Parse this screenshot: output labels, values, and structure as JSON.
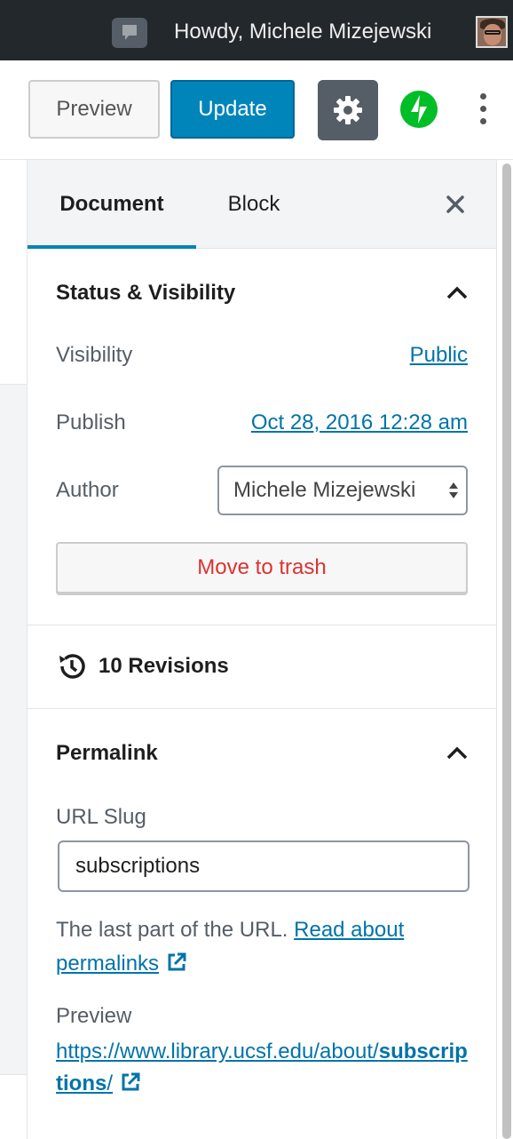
{
  "admin_bar": {
    "greeting": "Howdy, Michele Mizejewski"
  },
  "toolbar": {
    "preview_label": "Preview",
    "update_label": "Update"
  },
  "sidebar": {
    "tabs": [
      {
        "label": "Document",
        "active": true
      },
      {
        "label": "Block",
        "active": false
      }
    ],
    "status_visibility": {
      "title": "Status & Visibility",
      "visibility_label": "Visibility",
      "visibility_value": "Public",
      "publish_label": "Publish",
      "publish_value": "Oct 28, 2016 12:28 am",
      "author_label": "Author",
      "author_value": "Michele Mizejewski",
      "trash_label": "Move to trash"
    },
    "revisions": {
      "label": "10 Revisions"
    },
    "permalink": {
      "title": "Permalink",
      "slug_label": "URL Slug",
      "slug_value": "subscriptions",
      "help_text": "The last part of the URL.",
      "help_link": "Read about permalinks",
      "preview_label": "Preview",
      "preview_url_base": "https://www.library.ucsf.edu/about/",
      "preview_url_slug": "subscriptions",
      "preview_url_tail": "/"
    }
  },
  "colors": {
    "admin_bar": "#23282d",
    "primary": "#0085ba",
    "link": "#0073aa",
    "danger": "#dc3232",
    "jetpack": "#00be28"
  }
}
